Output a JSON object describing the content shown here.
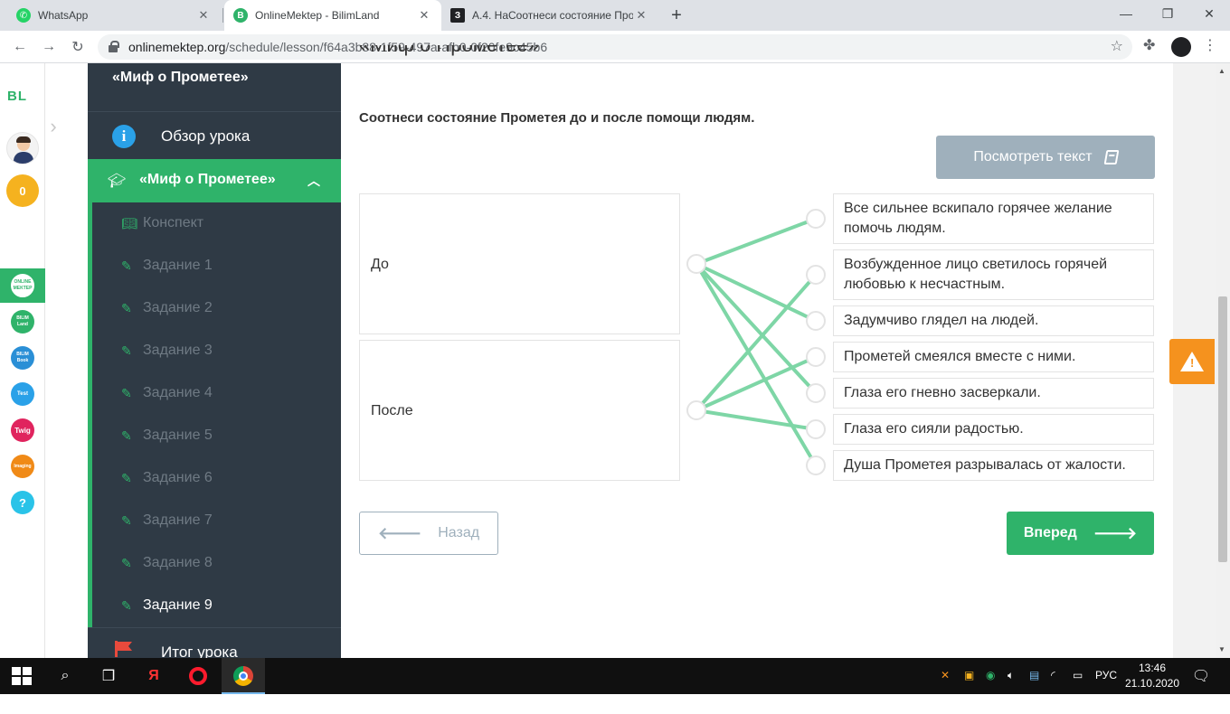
{
  "browser": {
    "tabs": [
      {
        "title": "WhatsApp",
        "active": false
      },
      {
        "title": "OnlineMektep - BilimLand",
        "active": true
      },
      {
        "title": "А.4. НаСоотнеси состояние Про",
        "active": false
      }
    ],
    "url_host": "onlinemektep.org",
    "url_path": "/schedule/lesson/f64a3b88-1f59-497a-afb0-0f20fe9c45b6"
  },
  "rail": {
    "logo": "BL",
    "coins": "0",
    "apps": [
      {
        "name": "online-mektep",
        "label": "ONLINE MEKTEP",
        "color": "#2fb36a"
      },
      {
        "name": "bilimland",
        "label": "BILIM Land",
        "color": "#2fb36a"
      },
      {
        "name": "bilimbook",
        "label": "BILIM Book",
        "color": "#2a8fd6"
      },
      {
        "name": "test",
        "label": "Test",
        "color": "#2aa1e8"
      },
      {
        "name": "twig",
        "label": "Twig",
        "color": "#e0245e"
      },
      {
        "name": "imaging",
        "label": "Imaging",
        "color": "#f08a17"
      },
      {
        "name": "help",
        "label": "?",
        "color": "#2ac3e8"
      }
    ]
  },
  "sidebar": {
    "course_title": "«Миф о Прометее»",
    "overview": "Обзор урока",
    "section_title": "«Миф о Прометее»",
    "items": [
      {
        "label": "Конспект",
        "icon": "book-open-icon"
      },
      {
        "label": "Задание 1",
        "icon": "edit-icon"
      },
      {
        "label": "Задание 2",
        "icon": "edit-icon"
      },
      {
        "label": "Задание 3",
        "icon": "edit-icon"
      },
      {
        "label": "Задание 4",
        "icon": "edit-icon"
      },
      {
        "label": "Задание 5",
        "icon": "edit-icon"
      },
      {
        "label": "Задание 6",
        "icon": "edit-icon"
      },
      {
        "label": "Задание 7",
        "icon": "edit-icon"
      },
      {
        "label": "Задание 8",
        "icon": "edit-icon"
      },
      {
        "label": "Задание 9",
        "icon": "edit-icon",
        "current": true
      }
    ],
    "final": "Итог урока"
  },
  "main": {
    "cut_title": "«Миф о Прометее»",
    "question": "Соотнеси состояние Прометея до и после помощи людям.",
    "view_text_label": "Посмотреть текст",
    "left_options": [
      "До",
      "После"
    ],
    "right_options": [
      "Все сильнее вскипало горячее желание помочь людям.",
      "Возбужденное лицо светилось горячей любовью к несчастным.",
      "Задумчиво глядел на людей.",
      "Прометей смеялся вместе с ними.",
      "Глаза его гневно засверкали.",
      "Глаза его сияли радостью.",
      "Душа Прометея разрывалась от жалости."
    ],
    "connections": [
      {
        "from": 0,
        "to": 0
      },
      {
        "from": 0,
        "to": 2
      },
      {
        "from": 0,
        "to": 4
      },
      {
        "from": 0,
        "to": 6
      },
      {
        "from": 1,
        "to": 1
      },
      {
        "from": 1,
        "to": 3
      },
      {
        "from": 1,
        "to": 5
      }
    ],
    "back_label": "Назад",
    "next_label": "Вперед"
  },
  "taskbar": {
    "language": "РУС",
    "time": "13:46",
    "date": "21.10.2020"
  },
  "colors": {
    "accent": "#2fb36a",
    "sidebar_bg": "#2f3a45",
    "line": "#7ed6a6",
    "warning": "#f5921e"
  }
}
